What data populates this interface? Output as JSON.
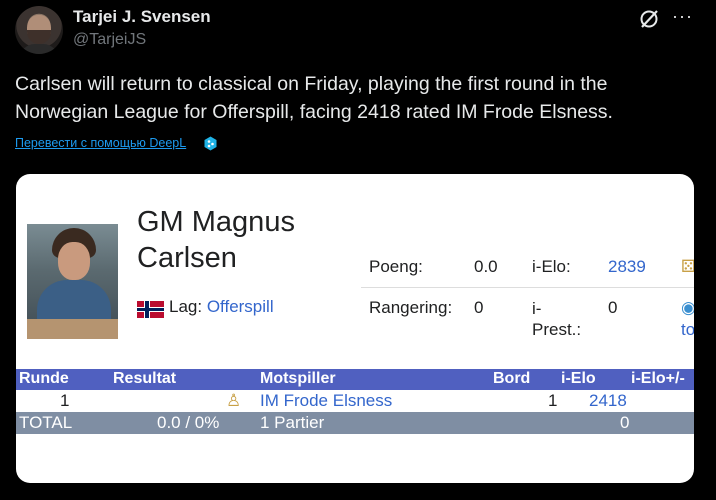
{
  "user": {
    "name": "Tarjei J. Svensen",
    "handle": "@TarjeiJS"
  },
  "header_icons": {
    "grok": "grok-icon",
    "more": "···"
  },
  "tweet": {
    "text": "Carlsen will return to classical on Friday, playing the first round in the Norwegian League for Offerspill, facing  2418 rated IM Frode Elsness.",
    "translate_link": "Перевести с помощью DeepL"
  },
  "card": {
    "player_title": "GM Magnus Carlsen",
    "team_label": "Lag:",
    "team_value": "Offerspill",
    "info": {
      "poeng_label": "Poeng:",
      "poeng_value": "0.0",
      "ielo_label": "i-Elo:",
      "ielo_value": "2839",
      "rangering_label": "Rangering:",
      "rangering_value": "0",
      "iprest_label": "i-Prest.:",
      "iprest_value": "0",
      "side_link": "to"
    },
    "results": {
      "headers": [
        "Runde",
        "Resultat",
        "Motspiller",
        "Bord",
        "i-Elo",
        "i-Elo+/-"
      ],
      "row1": {
        "runde": "1",
        "motspiller": "IM Frode Elsness",
        "bord": "1",
        "ielo": "2418"
      },
      "total": {
        "label": "TOTAL",
        "resultat": "0.0 / 0%",
        "motspiller": "1 Partier",
        "ielo": "0"
      }
    }
  }
}
